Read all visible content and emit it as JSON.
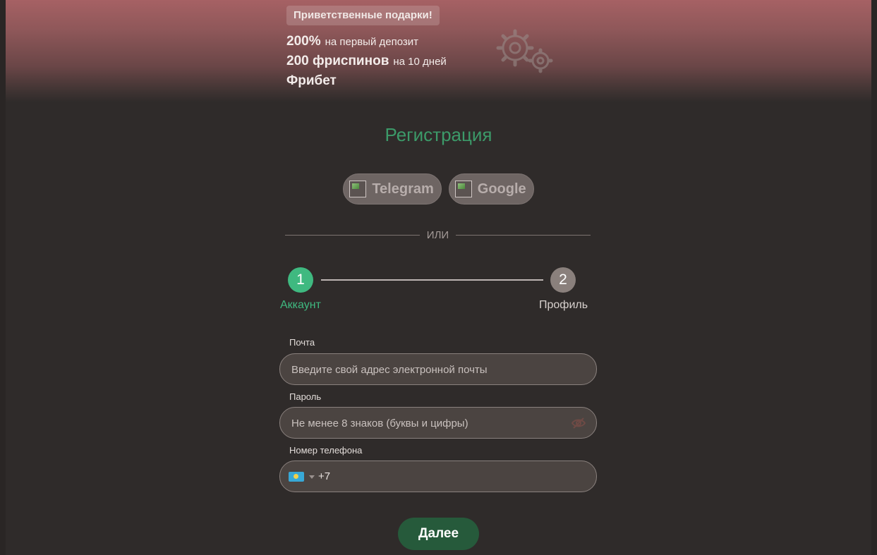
{
  "promo": {
    "badge": "Приветственные подарки!",
    "line1": {
      "big": "200%",
      "small": "на первый депозит"
    },
    "line2": {
      "big": "200 фриспинов",
      "small": "на 10 дней"
    },
    "line3": {
      "big": "Фрибет"
    },
    "decoration_icon": "gears-icon"
  },
  "registration": {
    "title": "Регистрация",
    "social": [
      {
        "label": "Telegram",
        "icon": "telegram-icon"
      },
      {
        "label": "Google",
        "icon": "google-icon"
      }
    ],
    "divider": "ИЛИ"
  },
  "stepper": {
    "steps": [
      {
        "number": "1",
        "label": "Аккаунт",
        "active": true
      },
      {
        "number": "2",
        "label": "Профиль",
        "active": false
      }
    ]
  },
  "form": {
    "email": {
      "label": "Почта",
      "placeholder": "Введите свой адрес электронной почты",
      "value": ""
    },
    "password": {
      "label": "Пароль",
      "placeholder": "Не менее 8 знаков (буквы и цифры)",
      "value": "",
      "toggle_icon": "eye-off-icon"
    },
    "phone": {
      "label": "Номер телефона",
      "country_icon": "kazakhstan-flag-icon",
      "dial_code": "+7",
      "value": ""
    },
    "submit_label": "Далее"
  },
  "colors": {
    "background": "#2f2b2a",
    "accent_green": "#3fb980",
    "title_green": "#3c9a69",
    "button_green": "#265a3b",
    "banner_top": "#a66164"
  }
}
